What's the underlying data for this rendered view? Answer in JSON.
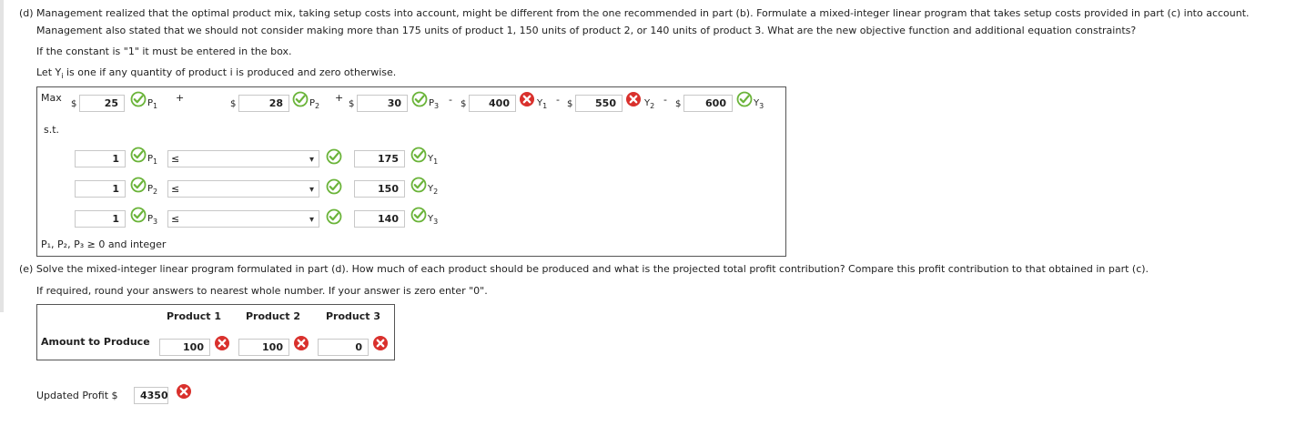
{
  "part_d": {
    "question": "(d) Management realized that the optimal product mix, taking setup costs into account, might be different from the one recommended in part (b). Formulate a mixed-integer linear program that takes setup costs provided in part (c) into account.",
    "line2": "Management also stated that we should not consider making more than 175 units of product 1, 150 units of product 2, or 140 units of product 3. What are the new objective function and additional equation constraints?",
    "line3": "If the constant is \"1\" it must be entered in the box.",
    "line4_prefix": "Let Y",
    "line4_sub": "i",
    "line4_suffix": " is one if any quantity of product i is produced and zero otherwise."
  },
  "model": {
    "max_label": "Max",
    "st_label": "s.t.",
    "dollar": "$",
    "plus": "+",
    "minus": "-",
    "objective": [
      {
        "value": "25",
        "var": "P",
        "sub": "1",
        "status": "correct"
      },
      {
        "value": "28",
        "var": "P",
        "sub": "2",
        "status": "correct"
      },
      {
        "value": "30",
        "var": "P",
        "sub": "3",
        "status": "correct"
      },
      {
        "value": "400",
        "var": "Y",
        "sub": "1",
        "status": "incorrect"
      },
      {
        "value": "550",
        "var": "Y",
        "sub": "2",
        "status": "incorrect"
      },
      {
        "value": "600",
        "var": "Y",
        "sub": "3",
        "status": "correct"
      }
    ],
    "constraints": [
      {
        "coef": "1",
        "var": "P",
        "sub": "1",
        "rel": "≤",
        "rhs": "175",
        "rhs_var": "Y",
        "rhs_sub": "1"
      },
      {
        "coef": "1",
        "var": "P",
        "sub": "2",
        "rel": "≤",
        "rhs": "150",
        "rhs_var": "Y",
        "rhs_sub": "2"
      },
      {
        "coef": "1",
        "var": "P",
        "sub": "3",
        "rel": "≤",
        "rhs": "140",
        "rhs_var": "Y",
        "rhs_sub": "3"
      }
    ],
    "nonneg": "P₁, P₂, P₃ ≥ 0 and integer"
  },
  "part_e": {
    "question": "(e) Solve the mixed-integer linear program formulated in part (d). How much of each product should be produced and what is the projected total profit contribution? Compare this profit contribution to that obtained in part (c).",
    "note": "If required, round your answers to nearest whole number. If your answer is zero enter \"0\".",
    "headers": [
      "Product 1",
      "Product 2",
      "Product 3"
    ],
    "row_label": "Amount to Produce",
    "amounts": [
      "100",
      "100",
      "0"
    ],
    "profit_label": "Updated Profit $",
    "profit_value": "4350"
  },
  "colors": {
    "correct": "#6bb43a",
    "incorrect": "#d9302c"
  }
}
